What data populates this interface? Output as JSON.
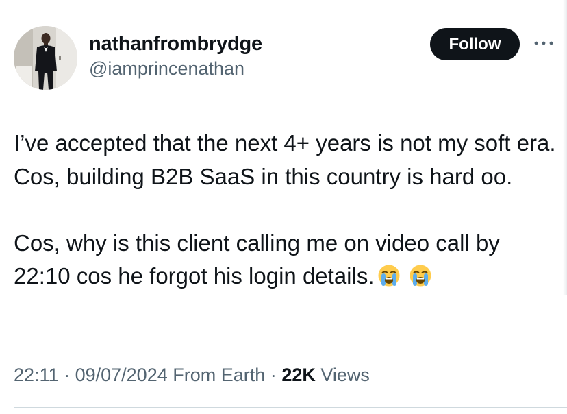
{
  "author": {
    "display_name": "nathanfrombrydge",
    "handle": "@iamprincenathan",
    "avatar_icon": "profile-photo-man-in-suit"
  },
  "actions": {
    "follow_label": "Follow",
    "more_icon": "more-horizontal-icon"
  },
  "tweet": {
    "paragraph_1": "I’ve accepted that the next 4+ years is not my soft era. Cos, building B2B SaaS in this country is hard oo.",
    "paragraph_2": "Cos, why is this client calling me on video call by 22:10 cos he forgot his login details.",
    "emojis": [
      "😭",
      "😭"
    ]
  },
  "meta": {
    "time": "22:11",
    "separator": "·",
    "date": "09/07/2024",
    "location": "From Earth",
    "views_count": "22K",
    "views_label": "Views"
  },
  "colors": {
    "text_primary": "#0f1419",
    "text_secondary": "#536471",
    "follow_bg": "#0f1419",
    "divider": "#cfd9de"
  }
}
